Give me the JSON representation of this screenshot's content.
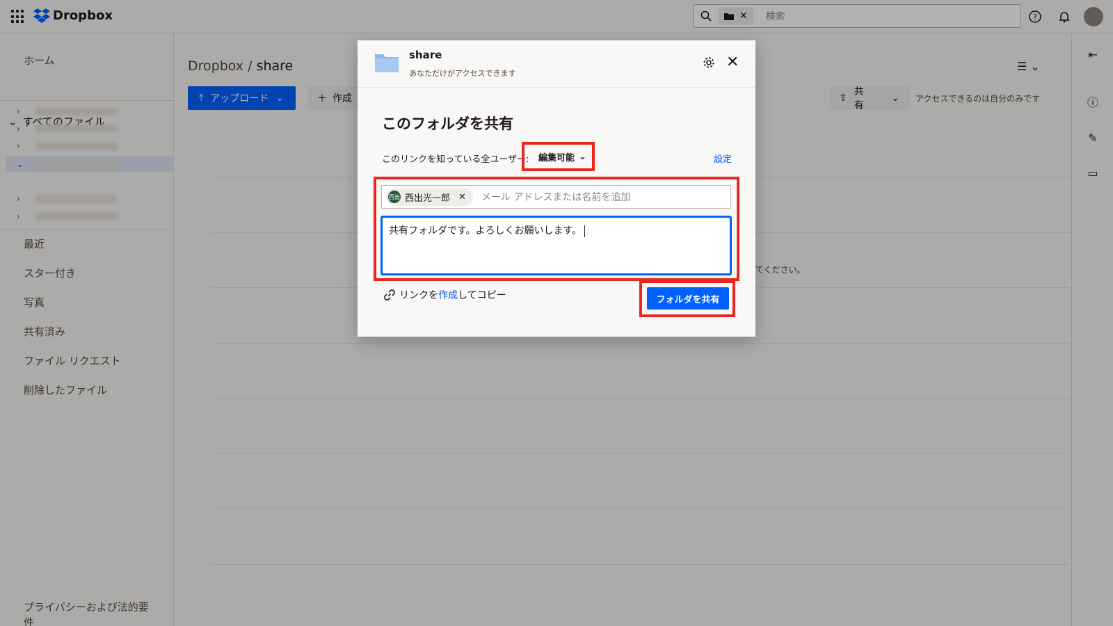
{
  "app": {
    "name": "Dropbox"
  },
  "search": {
    "placeholder": "検索"
  },
  "sidebar": {
    "home": "ホーム",
    "all_files": "すべてのファイル",
    "recent": "最近",
    "starred": "スター付き",
    "photos": "写真",
    "shared": "共有済み",
    "file_requests": "ファイル リクエスト",
    "deleted_files": "削除したファイル",
    "privacy": "プライバシーおよび法的要件"
  },
  "main": {
    "breadcrumb_root": "Dropbox",
    "breadcrumb_sep": "/",
    "breadcrumb_current": "share",
    "upload_label": "アップロード",
    "create_label": "作成",
    "share_label": "共有",
    "access_note": "アクセスできるのは自分のみです",
    "hint_fragment": "てください。"
  },
  "modal": {
    "folder_name": "share",
    "folder_access": "あなただけがアクセスできます",
    "heading": "このフォルダを共有",
    "link_perm_label": "このリンクを知っている全ユーザー:",
    "perm_value": "編集可能",
    "settings_link": "設定",
    "invitee_name": "西出光一郎",
    "invitee_initials": "西出",
    "invite_placeholder": "メール アドレスまたは名前を追加",
    "message_text": "共有フォルダです。よろしくお願いします。",
    "copy_link_prefix": "リンクを",
    "copy_link_action": "作成",
    "copy_link_suffix": "してコピー",
    "share_button": "フォルダを共有"
  },
  "colors": {
    "accent": "#0061fe",
    "highlight": "#e8271f",
    "background": "#f7f5f2"
  },
  "icons": [
    "apps-grid-icon",
    "dropbox-logo-icon",
    "search-icon",
    "folder-icon",
    "help-icon",
    "bell-icon",
    "gear-icon",
    "close-icon",
    "link-icon",
    "upload-icon",
    "plus-icon",
    "share-icon",
    "list-view-icon",
    "collapse-panel-icon",
    "info-icon",
    "pin-icon",
    "folder-settings-icon"
  ]
}
